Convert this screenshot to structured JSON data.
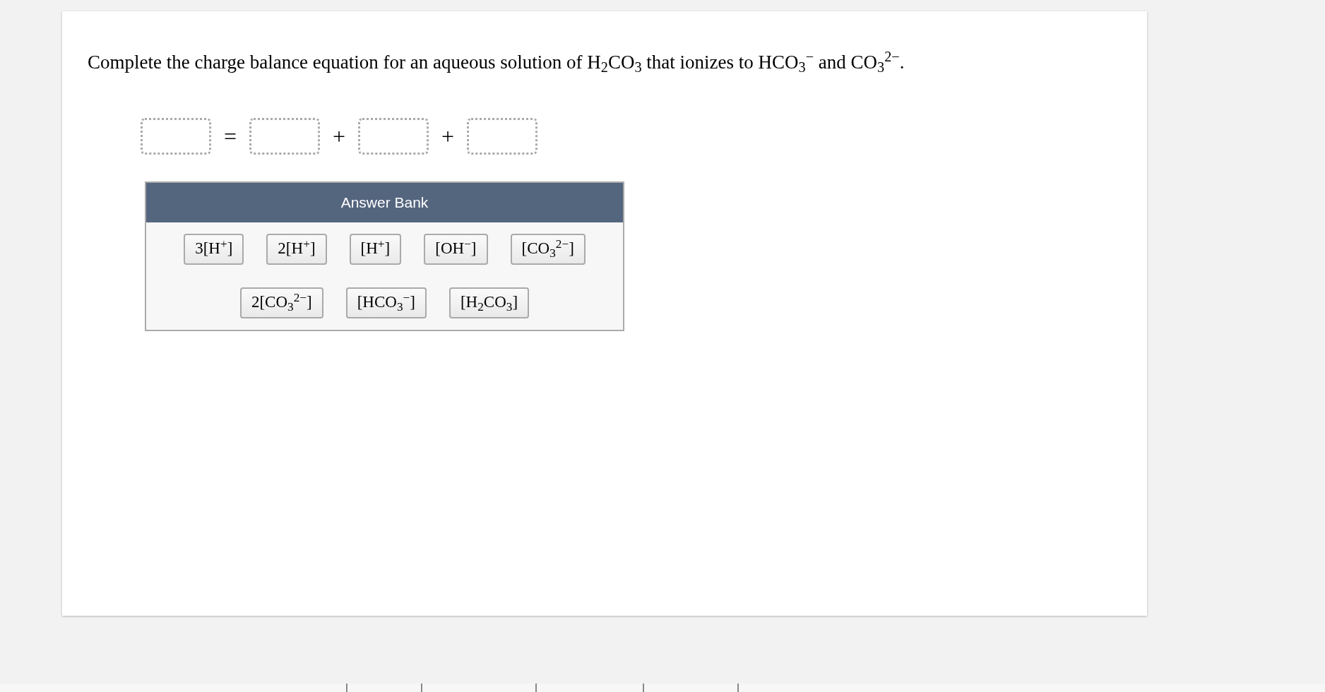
{
  "question": "Complete the charge balance equation for an aqueous solution of H$_{2}$CO$_{3}$ that ionizes to HCO$_{3}$$^{−}$ and CO$_{3}$$^{2−}$.",
  "equation": [
    {
      "kind": "slot"
    },
    {
      "kind": "operator",
      "symbol": "="
    },
    {
      "kind": "slot"
    },
    {
      "kind": "operator",
      "symbol": "+"
    },
    {
      "kind": "slot"
    },
    {
      "kind": "operator",
      "symbol": "+"
    },
    {
      "kind": "slot"
    }
  ],
  "answer_bank": {
    "title": "Answer Bank",
    "items": [
      "3[H$^{+}$]",
      "2[H$^{+}$]",
      "[H$^{+}$]",
      "[OH$^{−}$]",
      "[CO$_{3}$$^{2−}$]",
      "2[CO$_{3}$$^{2−}$]",
      "[HCO$_{3}$$^{−}$]",
      "[H$_{2}$CO$_{3}$]"
    ]
  }
}
